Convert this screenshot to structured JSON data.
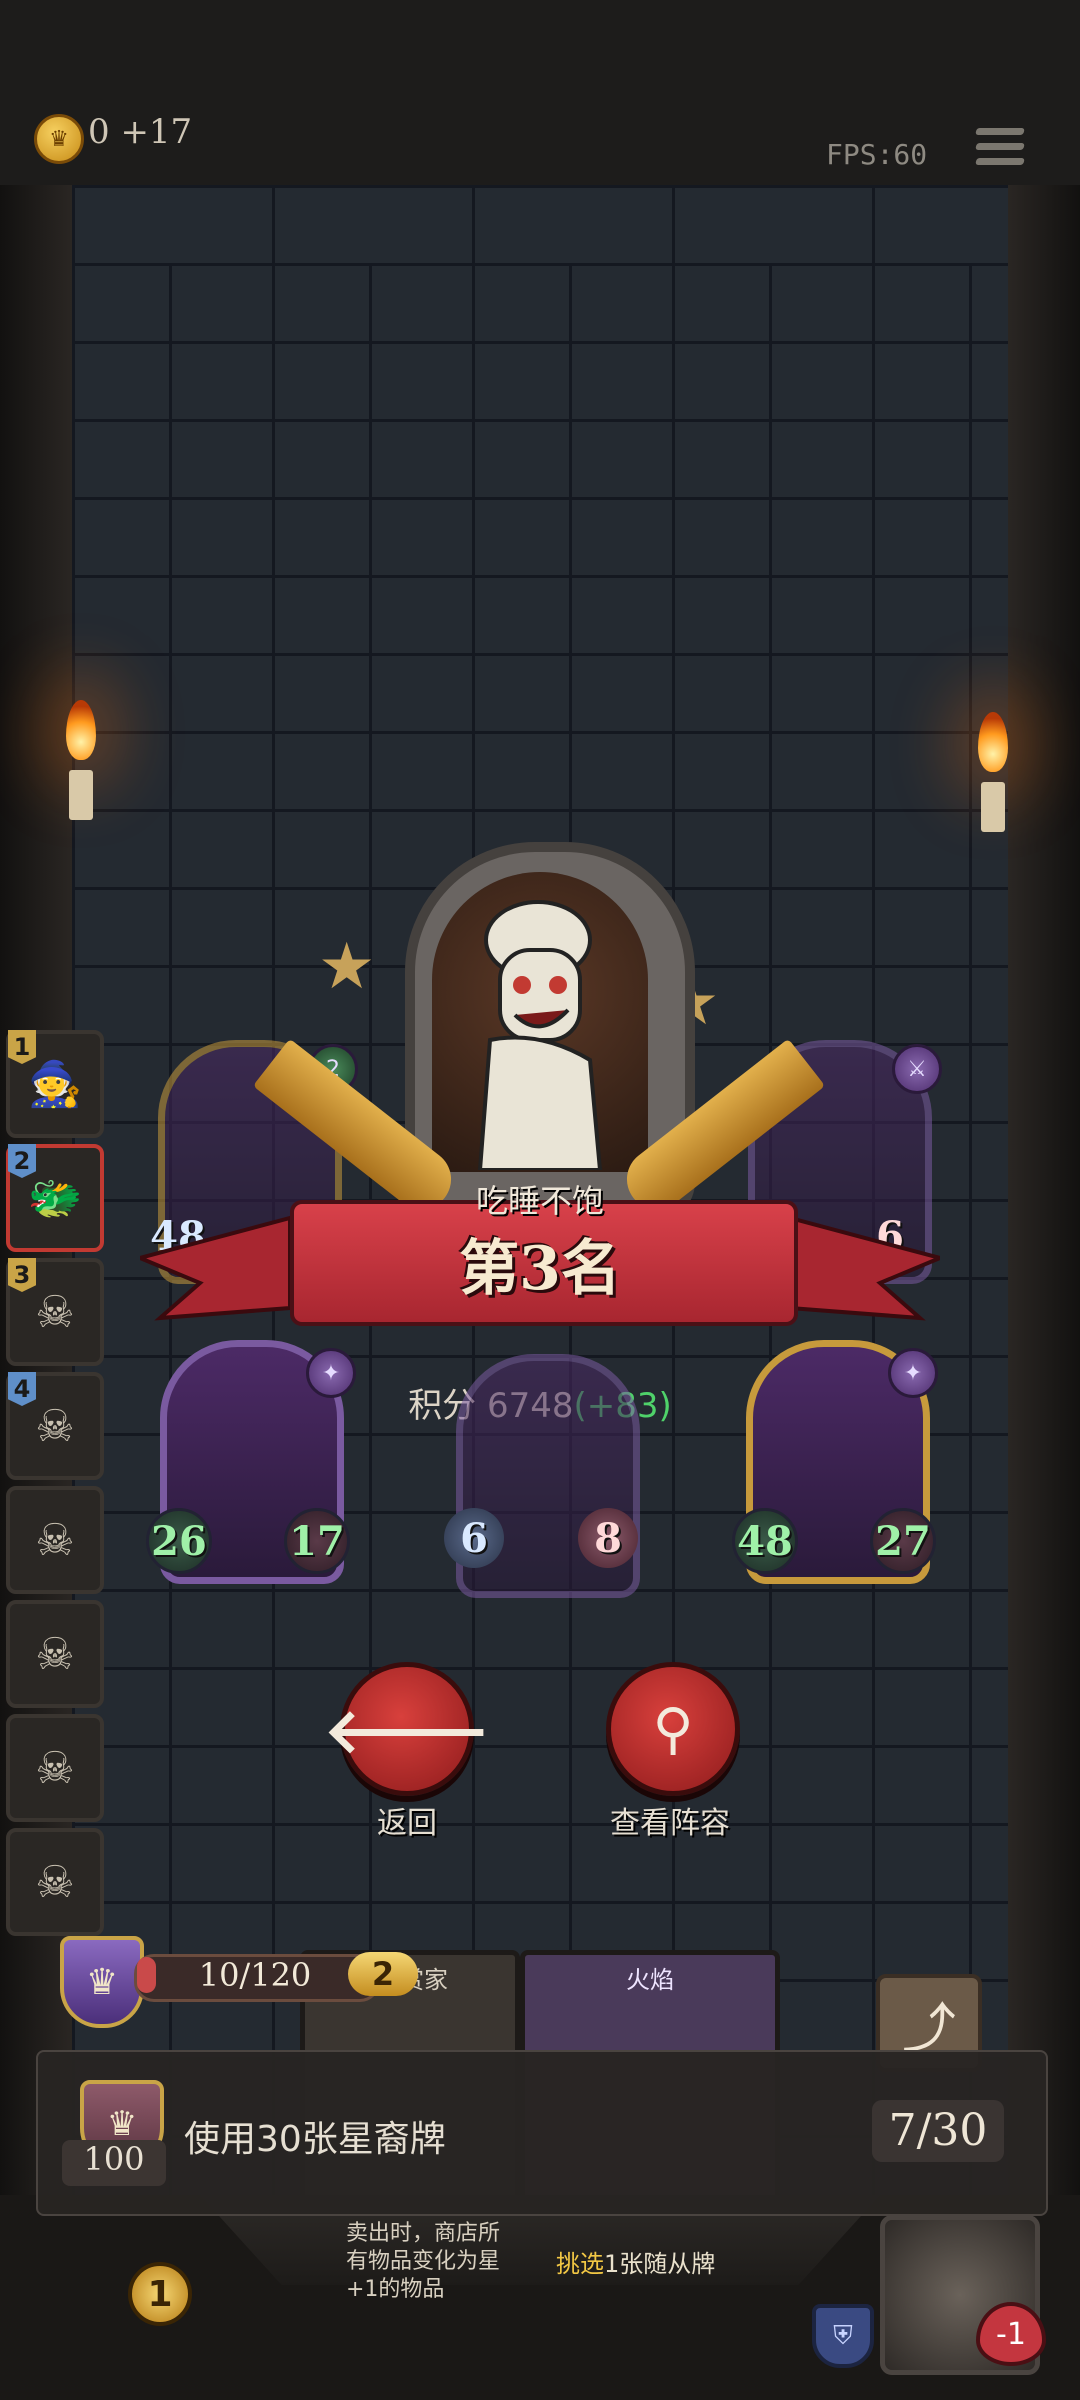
{
  "topbar": {
    "coins": "0 +17",
    "fps": "FPS:60"
  },
  "roster": [
    {
      "rank": "1",
      "state": "alive"
    },
    {
      "rank": "2",
      "state": "alive",
      "active": true
    },
    {
      "rank": "3",
      "state": "dead"
    },
    {
      "rank": "4",
      "state": "dead"
    },
    {
      "rank": "",
      "state": "dead"
    },
    {
      "rank": "",
      "state": "dead"
    },
    {
      "rank": "",
      "state": "dead"
    },
    {
      "rank": "",
      "state": "dead"
    }
  ],
  "result": {
    "player_name": "吃睡不饱",
    "rank_label": "第3名",
    "score_label": "积分",
    "score_value": "6748",
    "score_delta": "(+83)"
  },
  "team_top": {
    "left_badge": "2",
    "left_stat": "48",
    "right_stat": "6"
  },
  "team": [
    {
      "atk": "26",
      "hp": "17"
    },
    {
      "atk": "6",
      "hp": "8"
    },
    {
      "atk": "48",
      "hp": "27"
    }
  ],
  "buttons": {
    "back_label": "返回",
    "view_label": "查看阵容"
  },
  "tavern": {
    "exp": "10/120",
    "level": "2",
    "card1_title": "赏家",
    "card1_desc": "卖出时，商店所有物品变化为星+1的物品",
    "card2_title": "火焰",
    "card2_desc_highlight": "挑选",
    "card2_desc_rest": "1张随从牌"
  },
  "quest": {
    "text": "使用30张星裔牌",
    "reward": "100",
    "progress": "7/30"
  },
  "tray": {
    "gold": "1",
    "health_delta": "-1"
  },
  "colors": {
    "banner_red": "#c8343c",
    "score_delta_green": "#4fd26a",
    "wall": "#242a31"
  }
}
